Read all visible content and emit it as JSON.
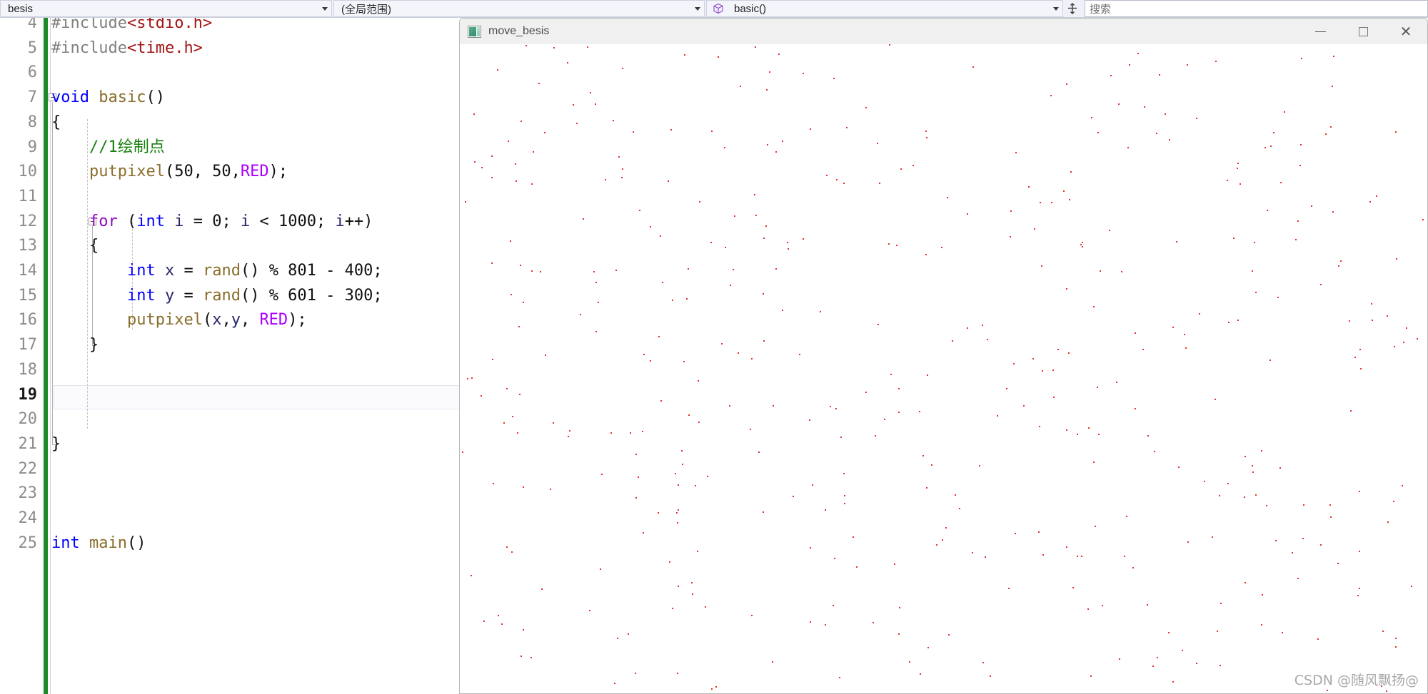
{
  "nav": {
    "project_combo": "besis",
    "scope_combo": "(全局范围)",
    "member_combo": "basic()",
    "member_icon": "cube-icon",
    "splitter_icon": "split-window-icon",
    "search_placeholder": "搜索"
  },
  "editor": {
    "first_visible_line": 4,
    "current_line": 19,
    "line_numbers": [
      4,
      5,
      6,
      7,
      8,
      9,
      10,
      11,
      12,
      13,
      14,
      15,
      16,
      17,
      18,
      19,
      20,
      21,
      22,
      23,
      24,
      25
    ],
    "lines": [
      {
        "n": 4,
        "tokens": [
          {
            "t": "#include",
            "c": "pre"
          },
          {
            "t": "<stdio.h>",
            "c": "str"
          }
        ]
      },
      {
        "n": 5,
        "tokens": [
          {
            "t": "#include",
            "c": "pre"
          },
          {
            "t": "<time.h>",
            "c": "str"
          }
        ]
      },
      {
        "n": 6,
        "tokens": []
      },
      {
        "n": 7,
        "tokens": [
          {
            "t": "void",
            "c": "kw"
          },
          {
            "t": " ",
            "c": "plain"
          },
          {
            "t": "basic",
            "c": "fn"
          },
          {
            "t": "()",
            "c": "plain"
          }
        ]
      },
      {
        "n": 8,
        "tokens": [
          {
            "t": "{",
            "c": "plain"
          }
        ]
      },
      {
        "n": 9,
        "tokens": [
          {
            "t": "    //1绘制点",
            "c": "cmt"
          }
        ]
      },
      {
        "n": 10,
        "tokens": [
          {
            "t": "    ",
            "c": "plain"
          },
          {
            "t": "putpixel",
            "c": "fn"
          },
          {
            "t": "(50, 50,",
            "c": "plain"
          },
          {
            "t": "RED",
            "c": "macro"
          },
          {
            "t": ");",
            "c": "plain"
          }
        ]
      },
      {
        "n": 11,
        "tokens": []
      },
      {
        "n": 12,
        "tokens": [
          {
            "t": "    ",
            "c": "plain"
          },
          {
            "t": "for",
            "c": "kw2"
          },
          {
            "t": " (",
            "c": "plain"
          },
          {
            "t": "int",
            "c": "kw"
          },
          {
            "t": " ",
            "c": "plain"
          },
          {
            "t": "i",
            "c": "var"
          },
          {
            "t": " = 0; ",
            "c": "plain"
          },
          {
            "t": "i",
            "c": "var"
          },
          {
            "t": " < 1000; ",
            "c": "plain"
          },
          {
            "t": "i",
            "c": "var"
          },
          {
            "t": "++)",
            "c": "plain"
          }
        ]
      },
      {
        "n": 13,
        "tokens": [
          {
            "t": "    {",
            "c": "plain"
          }
        ]
      },
      {
        "n": 14,
        "tokens": [
          {
            "t": "        ",
            "c": "plain"
          },
          {
            "t": "int",
            "c": "kw"
          },
          {
            "t": " ",
            "c": "plain"
          },
          {
            "t": "x",
            "c": "var"
          },
          {
            "t": " = ",
            "c": "plain"
          },
          {
            "t": "rand",
            "c": "fn"
          },
          {
            "t": "() % 801 - 400;",
            "c": "plain"
          }
        ]
      },
      {
        "n": 15,
        "tokens": [
          {
            "t": "        ",
            "c": "plain"
          },
          {
            "t": "int",
            "c": "kw"
          },
          {
            "t": " ",
            "c": "plain"
          },
          {
            "t": "y",
            "c": "var"
          },
          {
            "t": " = ",
            "c": "plain"
          },
          {
            "t": "rand",
            "c": "fn"
          },
          {
            "t": "() % 601 - 300;",
            "c": "plain"
          }
        ]
      },
      {
        "n": 16,
        "tokens": [
          {
            "t": "        ",
            "c": "plain"
          },
          {
            "t": "putpixel",
            "c": "fn"
          },
          {
            "t": "(",
            "c": "plain"
          },
          {
            "t": "x",
            "c": "var"
          },
          {
            "t": ",",
            "c": "plain"
          },
          {
            "t": "y",
            "c": "var"
          },
          {
            "t": ", ",
            "c": "plain"
          },
          {
            "t": "RED",
            "c": "macro"
          },
          {
            "t": ");",
            "c": "plain"
          }
        ]
      },
      {
        "n": 17,
        "tokens": [
          {
            "t": "    }",
            "c": "plain"
          }
        ]
      },
      {
        "n": 18,
        "tokens": []
      },
      {
        "n": 19,
        "tokens": []
      },
      {
        "n": 20,
        "tokens": []
      },
      {
        "n": 21,
        "tokens": [
          {
            "t": "}",
            "c": "plain"
          }
        ]
      },
      {
        "n": 22,
        "tokens": []
      },
      {
        "n": 23,
        "tokens": []
      },
      {
        "n": 24,
        "tokens": []
      },
      {
        "n": 25,
        "tokens": [
          {
            "t": "int",
            "c": "kw"
          },
          {
            "t": " ",
            "c": "plain"
          },
          {
            "t": "main",
            "c": "fn"
          },
          {
            "t": "()",
            "c": "plain"
          }
        ]
      }
    ],
    "colors": {
      "preprocessor": "#808080",
      "string": "#a31515",
      "keyword": "#0000ff",
      "keyword_control": "#8f08c4",
      "function": "#8a6d2b",
      "macro": "#aa00ff",
      "variable": "#26266b",
      "comment": "#18800f",
      "change_bar": "#1c8a26"
    }
  },
  "app_window": {
    "title": "move_besis",
    "icon": "app-window-icon",
    "controls": {
      "minimize": "minimize-icon",
      "maximize": "maximize-icon",
      "close": "close-icon"
    },
    "canvas": {
      "background": "#ffffff",
      "dot_color": "#e83030",
      "dot_count": 420
    },
    "watermark": "CSDN @随风飘扬@"
  }
}
